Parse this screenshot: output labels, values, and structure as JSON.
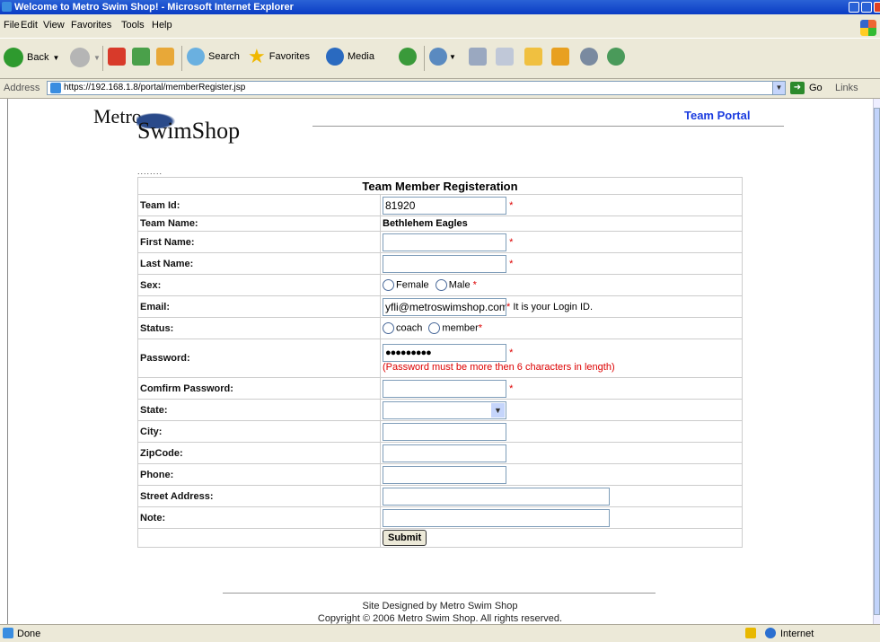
{
  "window": {
    "title": "Welcome to Metro Swim Shop! - Microsoft Internet Explorer"
  },
  "menu": [
    "File",
    "Edit",
    "View",
    "Favorites",
    "Tools",
    "Help"
  ],
  "toolbar": {
    "back": "Back",
    "search": "Search",
    "favorites": "Favorites",
    "media": "Media"
  },
  "address": {
    "label": "Address",
    "url": "https://192.168.1.8/portal/memberRegister.jsp",
    "go": "Go",
    "links": "Links"
  },
  "header": {
    "logo_top": "Metro",
    "logo_bottom": "SwimShop",
    "portal_link": "Team Portal"
  },
  "form": {
    "dots": "........",
    "title": "Team Member Registeration",
    "required_mark": "*",
    "team_id": {
      "label": "Team Id:",
      "value": "81920"
    },
    "team_name": {
      "label": "Team Name:",
      "value": "Bethlehem Eagles"
    },
    "first_name": {
      "label": "First Name:",
      "value": ""
    },
    "last_name": {
      "label": "Last Name:",
      "value": ""
    },
    "sex": {
      "label": "Sex:",
      "options": [
        "Female",
        "Male"
      ]
    },
    "email": {
      "label": "Email:",
      "value": "yfli@metroswimshop.com",
      "note": "It is your Login ID."
    },
    "status": {
      "label": "Status:",
      "options": [
        "coach",
        "member"
      ]
    },
    "password": {
      "label": "Password:",
      "value": "●●●●●●●●●",
      "note": "(Password must be more then 6 characters in length)"
    },
    "confirm_password": {
      "label": "Comfirm Password:",
      "value": ""
    },
    "state": {
      "label": "State:",
      "value": ""
    },
    "city": {
      "label": "City:",
      "value": ""
    },
    "zipcode": {
      "label": "ZipCode:",
      "value": ""
    },
    "phone": {
      "label": "Phone:",
      "value": ""
    },
    "street": {
      "label": "Street Address:",
      "value": ""
    },
    "note": {
      "label": "Note:",
      "value": ""
    },
    "submit": "Submit"
  },
  "footer": {
    "line1": "Site Designed by Metro Swim Shop",
    "line2": "Copyright © 2006 Metro Swim Shop. All rights reserved."
  },
  "status": {
    "text": "Done",
    "zone": "Internet"
  }
}
